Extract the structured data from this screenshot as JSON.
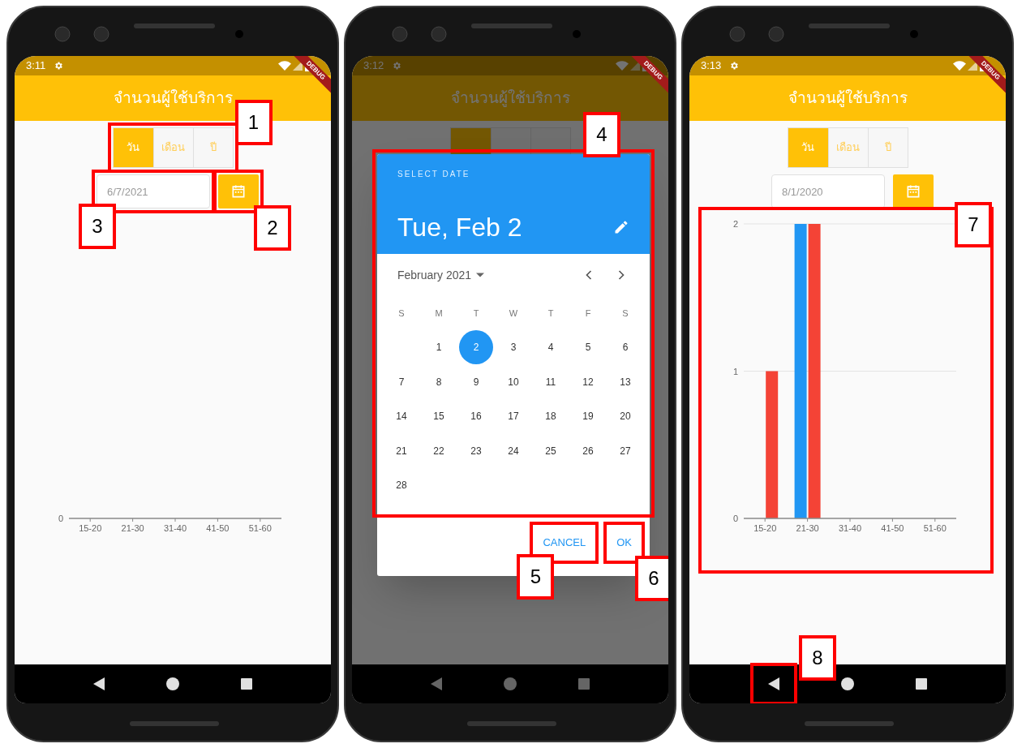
{
  "phones": [
    {
      "status_time": "3:11",
      "debug_banner": "DEBUG",
      "title": "จำนวนผู้ใช้บริการ",
      "dimmed": false,
      "segments": {
        "annotation": "1",
        "items": [
          {
            "label": "วัน",
            "selected": true
          },
          {
            "label": "เดือน",
            "selected": false
          },
          {
            "label": "ปี",
            "selected": false
          }
        ]
      },
      "date_field": {
        "value": "6/7/2021",
        "annotation": "3",
        "calendar_button_annotation": "2"
      },
      "empty_chart": {
        "zero_label": "0",
        "categories": [
          "15-20",
          "21-30",
          "31-40",
          "41-50",
          "51-60"
        ]
      }
    },
    {
      "status_time": "3:12",
      "debug_banner": "DEBUG",
      "title": "จำนวนผู้ใช้บริการ",
      "dimmed": true,
      "segments": {
        "items": [
          {
            "selected": true
          },
          {
            "selected": false
          },
          {
            "selected": false
          }
        ]
      },
      "dialog": {
        "annotation": "4",
        "header_label": "SELECT DATE",
        "selected_date": "Tue, Feb 2",
        "month_label": "February 2021",
        "weekdays": [
          "S",
          "M",
          "T",
          "W",
          "T",
          "F",
          "S"
        ],
        "weeks": [
          [
            {
              "label": "1",
              "selected": false
            },
            {
              "label": "2",
              "selected": true
            },
            {
              "label": "3",
              "selected": false
            },
            {
              "label": "4",
              "selected": false
            },
            {
              "label": "5",
              "selected": false
            },
            {
              "label": "6",
              "selected": false
            }
          ],
          [
            {
              "label": "7",
              "selected": false
            },
            {
              "label": "8",
              "selected": false
            },
            {
              "label": "9",
              "selected": false
            },
            {
              "label": "10",
              "selected": false
            },
            {
              "label": "11",
              "selected": false
            },
            {
              "label": "12",
              "selected": false
            },
            {
              "label": "13",
              "selected": false
            }
          ],
          [
            {
              "label": "14",
              "selected": false
            },
            {
              "label": "15",
              "selected": false
            },
            {
              "label": "16",
              "selected": false
            },
            {
              "label": "17",
              "selected": false
            },
            {
              "label": "18",
              "selected": false
            },
            {
              "label": "19",
              "selected": false
            },
            {
              "label": "20",
              "selected": false
            }
          ],
          [
            {
              "label": "21",
              "selected": false
            },
            {
              "label": "22",
              "selected": false
            },
            {
              "label": "23",
              "selected": false
            },
            {
              "label": "24",
              "selected": false
            },
            {
              "label": "25",
              "selected": false
            },
            {
              "label": "26",
              "selected": false
            },
            {
              "label": "27",
              "selected": false
            }
          ],
          [
            {
              "label": "28",
              "selected": false
            }
          ]
        ],
        "actions": [
          {
            "label": "CANCEL",
            "annotation": "5"
          },
          {
            "label": "OK",
            "annotation": "6"
          }
        ]
      }
    },
    {
      "status_time": "3:13",
      "debug_banner": "DEBUG",
      "title": "จำนวนผู้ใช้บริการ",
      "dimmed": false,
      "segments": {
        "items": [
          {
            "label": "วัน",
            "selected": true
          },
          {
            "label": "เดือน",
            "selected": false
          },
          {
            "label": "ปี",
            "selected": false
          }
        ]
      },
      "date_field": {
        "value": "8/1/2020"
      },
      "chart": {
        "annotation": "7",
        "chart_data": {
          "type": "bar",
          "categories": [
            "15-20",
            "21-30",
            "31-40",
            "41-50",
            "51-60"
          ],
          "yticks": [
            0,
            1,
            2
          ],
          "ylim": [
            0,
            2
          ],
          "series": [
            {
              "color": "#2196f3",
              "values": [
                0,
                2,
                0,
                0,
                0
              ]
            },
            {
              "color": "#f44336",
              "values": [
                1,
                2,
                0,
                0,
                0
              ]
            }
          ]
        }
      },
      "nav": {
        "back_annotation": "8"
      }
    }
  ]
}
